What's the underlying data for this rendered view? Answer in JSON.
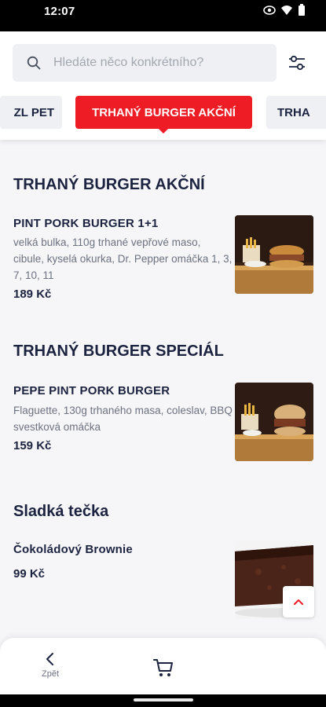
{
  "status": {
    "time": "12:07"
  },
  "search": {
    "placeholder": "Hledáte něco konkrétního?"
  },
  "tabs": [
    {
      "label": "ZL PET"
    },
    {
      "label": "TRHANÝ BURGER AKČNÍ"
    },
    {
      "label": "TRHA"
    }
  ],
  "sections": [
    {
      "title": "TRHANÝ BURGER AKČNÍ",
      "items": [
        {
          "name": "PINT PORK BURGER 1+1",
          "desc": "velká bulka, 110g trhané vepřové maso, cibule, kyselá okurka, Dr. Pepper omáčka 1, 3, 7, 10, 11",
          "price": "189 Kč"
        }
      ]
    },
    {
      "title": "TRHANÝ BURGER SPECIÁL",
      "items": [
        {
          "name": "PEPE PINT PORK BURGER",
          "desc": "Flaguette, 130g trhaného masa, coleslav, BBQ svestková omáčka",
          "price": "159 Kč"
        }
      ]
    },
    {
      "title": "Sladká tečka",
      "items": [
        {
          "name": "Čokoládový Brownie",
          "desc": "",
          "price": "99 Kč"
        }
      ]
    }
  ],
  "bottom": {
    "back_label": "Zpět"
  },
  "colors": {
    "accent": "#ee1c24",
    "text": "#1c2340",
    "muted": "#6c7280"
  }
}
